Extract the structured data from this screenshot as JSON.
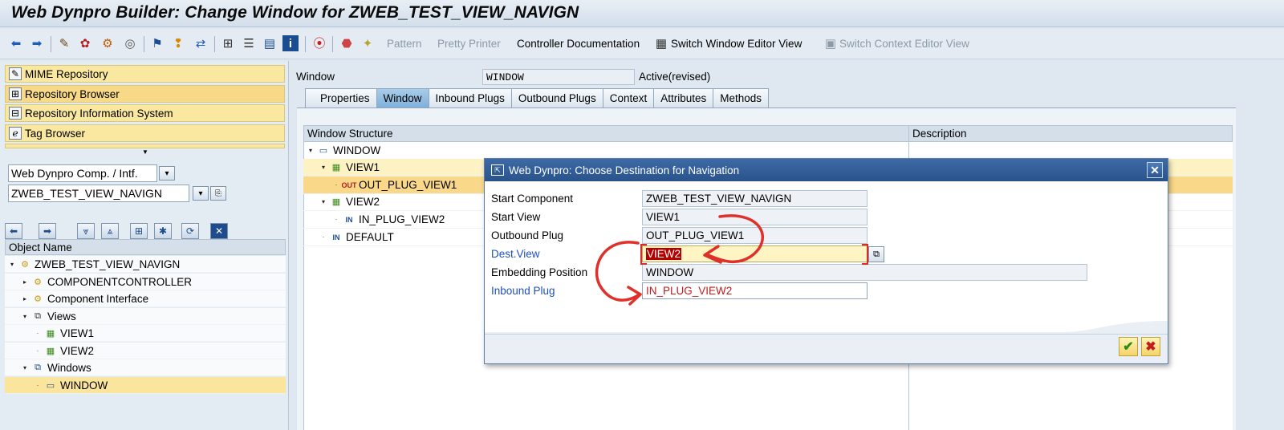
{
  "window_title": "Web Dynpro Builder: Change Window for ZWEB_TEST_VIEW_NAVIGN",
  "toolbar": {
    "pattern": "Pattern",
    "pretty_printer": "Pretty Printer",
    "controller_documentation": "Controller Documentation",
    "switch_window_editor": "Switch Window Editor View",
    "switch_context_editor": "Switch Context Editor View"
  },
  "nav": {
    "mime_repository": "MIME Repository",
    "repository_browser": "Repository Browser",
    "repository_information_system": "Repository Information System",
    "tag_browser": "Tag Browser"
  },
  "object_selector": {
    "type_value": "Web Dynpro Comp. / Intf.",
    "name_value": "ZWEB_TEST_VIEW_NAVIGN"
  },
  "object_tree": {
    "header": "Object Name",
    "rows": [
      "ZWEB_TEST_VIEW_NAVIGN",
      "COMPONENTCONTROLLER",
      "Component Interface",
      "Views",
      "VIEW1",
      "VIEW2",
      "Windows",
      "WINDOW"
    ]
  },
  "window_header": {
    "label": "Window",
    "value": "WINDOW",
    "status": "Active(revised)"
  },
  "tabs": [
    "Properties",
    "Window",
    "Inbound Plugs",
    "Outbound Plugs",
    "Context",
    "Attributes",
    "Methods"
  ],
  "window_structure": {
    "col_structure": "Window Structure",
    "col_description": "Description",
    "rows": [
      "WINDOW",
      "VIEW1",
      "OUT_PLUG_VIEW1",
      "VIEW2",
      "IN_PLUG_VIEW2",
      "DEFAULT"
    ]
  },
  "dialog": {
    "title": "Web Dynpro: Choose Destination for Navigation",
    "fields": {
      "start_component_label": "Start Component",
      "start_component_value": "ZWEB_TEST_VIEW_NAVIGN",
      "start_view_label": "Start View",
      "start_view_value": "VIEW1",
      "outbound_plug_label": "Outbound Plug",
      "outbound_plug_value": "OUT_PLUG_VIEW1",
      "dest_view_label": "Dest.View",
      "dest_view_value": "VIEW2",
      "embedding_position_label": "Embedding Position",
      "embedding_position_value": "WINDOW",
      "inbound_plug_label": "Inbound Plug",
      "inbound_plug_value": "IN_PLUG_VIEW2"
    }
  },
  "colors": {
    "accent_yellow": "#fbe8a0",
    "dialog_title_blue": "#2a538c",
    "annotation_red": "#e0302a"
  }
}
